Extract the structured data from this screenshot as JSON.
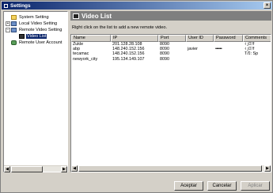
{
  "window": {
    "title": "Settings",
    "close_glyph": "×"
  },
  "tree": {
    "items": [
      {
        "label": "System Setting",
        "expander": "",
        "icon": "folder-icon",
        "indent": 0
      },
      {
        "label": "Local Video Setting",
        "expander": "+",
        "icon": "monitor-icon",
        "indent": 0
      },
      {
        "label": "Remote Video Setting",
        "expander": "−",
        "icon": "monitor-icon",
        "indent": 0
      },
      {
        "label": "Video List",
        "expander": "",
        "icon": "film-icon",
        "indent": 1,
        "selected": true
      },
      {
        "label": "Remote User Account",
        "expander": "",
        "icon": "person-icon",
        "indent": 0
      }
    ],
    "scroll_left": "◀",
    "scroll_right": "▶"
  },
  "panel": {
    "title": "Video List",
    "hint": "Right click on the list to add a new remote video."
  },
  "table": {
    "columns": [
      "Name",
      "IP",
      "Port",
      "User ID",
      "Password",
      "Comments"
    ],
    "rows": [
      [
        "Zukle",
        "201.128.28.108",
        "8090",
        "",
        "",
        "ｨ｣ﾛｧf"
      ],
      [
        "abp",
        "148.240.152.156",
        "8090",
        "javier",
        "••••••",
        "ｨ｣ﾛｧf"
      ],
      [
        "tecamac",
        "148.240.152.156",
        "8090",
        "",
        "",
        "T/ﾛ: Sp"
      ],
      [
        "newyork_city",
        "195.134.149.107",
        "8090",
        "",
        "",
        ""
      ]
    ]
  },
  "buttons": {
    "accept": "Aceptar",
    "cancel": "Cancelar",
    "apply": "Aplicar"
  },
  "colors": {
    "selection": "#0a246a",
    "header_bar": "#7f7f7f",
    "dialog_bg": "#d4d0c8"
  }
}
